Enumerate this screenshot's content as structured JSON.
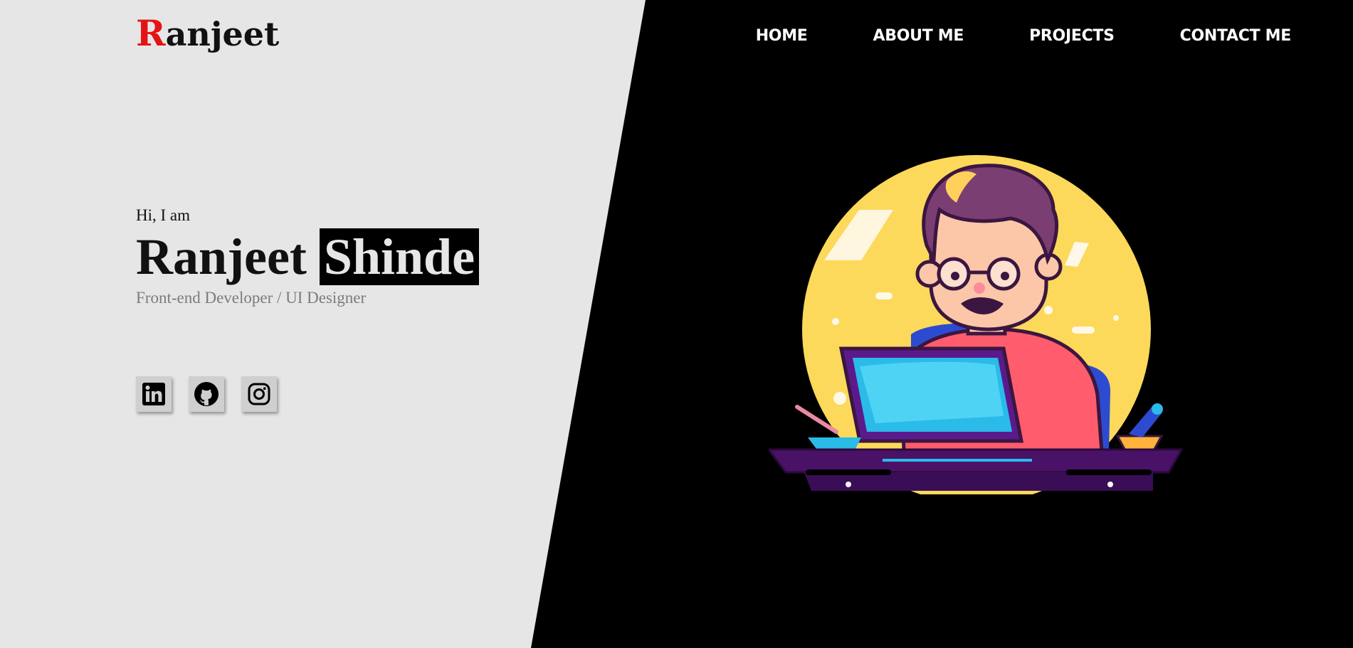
{
  "logo": {
    "initial": "R",
    "rest": "anjeet"
  },
  "nav": {
    "items": [
      {
        "label": "HOME"
      },
      {
        "label": "ABOUT ME"
      },
      {
        "label": "PROJECTS"
      },
      {
        "label": "CONTACT ME"
      }
    ]
  },
  "hero": {
    "greeting": "Hi, I am",
    "first_name": "Ranjeet",
    "last_name": "Shinde",
    "role": "Front-end Developer / UI Designer"
  },
  "socials": [
    {
      "icon": "linkedin-icon"
    },
    {
      "icon": "github-icon"
    },
    {
      "icon": "instagram-icon"
    }
  ],
  "colors": {
    "left_bg": "#e6e6e6",
    "right_bg": "#000000",
    "logo_accent": "#e31414",
    "role_text": "#7c7c7c"
  }
}
